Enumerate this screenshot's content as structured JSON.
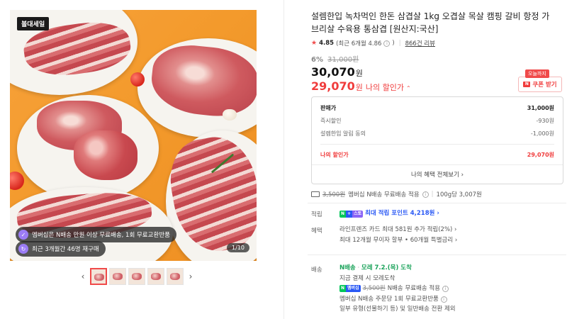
{
  "gallery": {
    "brand_badge": "볼대세일",
    "chip1": "멤버십은 N배송 만원 이상 무료배송, 1회 무료교환반품",
    "chip2": "최근 3개월간 46명 재구매",
    "counter": "1/10",
    "prev_icon": "chevron-left-icon",
    "next_icon": "chevron-right-icon"
  },
  "product": {
    "title": "설렘한입 녹차먹인 한돈 삼겹살 1kg 오겹살 목살 캠핑 갈비 항정 가브리살 수육용 통삼겹 [원산지:국산]",
    "rating": "4.85",
    "rating_recent": "(최근 6개월 4.86",
    "review_count": "866건 리뷰",
    "discount_pct": "6%",
    "original_price": "31,000원",
    "price": "30,070",
    "price_unit": "원",
    "my_price": "29,070",
    "my_price_unit": "원",
    "my_price_label": "나의 할인가"
  },
  "coupon": {
    "tag": "오늘까지",
    "label": "쿠폰 받기"
  },
  "breakdown": {
    "rows": [
      {
        "label": "판매가",
        "value": "31,000원"
      },
      {
        "label": "즉시할인",
        "value": "-930원"
      },
      {
        "label": "설렘한입 알림 동의",
        "value": "-1,000원"
      }
    ],
    "total_label": "나의 할인가",
    "total_value": "29,070원",
    "footer": "나의 혜택 전체보기 ›"
  },
  "shipping_line": {
    "strike": "3,500원",
    "text": "멤버십 N배송 무료배송 적용",
    "extra": "100g당 3,007원"
  },
  "points": {
    "label": "적립",
    "badge_n": "N",
    "badge_plus": "+",
    "badge_x": "스토",
    "text": "최대 적립 포인트 4,218원 ›"
  },
  "benefits": {
    "label": "혜택",
    "line1": "라인프렌즈 카드 최대 581원 추가 적립(2%) ›",
    "line2": "최대 12개월 무이자 할부 • 60개월 특별금리 ›"
  },
  "delivery": {
    "label": "배송",
    "line1_brand": "N배송",
    "line1_text": "모레 7.2.(목) 도착",
    "line2": "지금 결제 시 모레도착",
    "line3_badge": "멤버십",
    "line3_strike": "3,500원",
    "line3_text": "N배송 무료배송 적용",
    "line4": "멤버십 N배송 주문당 1회 무료교환반품",
    "line5": "일부 유형(선물하기 등) 및 일반배송 전환 제외"
  }
}
